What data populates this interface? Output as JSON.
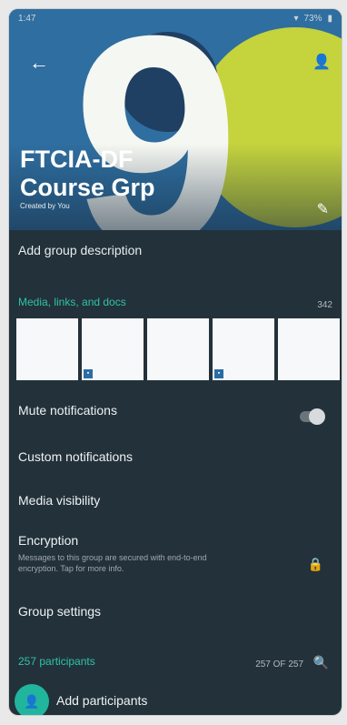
{
  "status_bar": {
    "time": "1:47",
    "battery": "73%"
  },
  "header": {
    "title_line1": "FTCIA-DF",
    "title_line2": "Course",
    "title_suffix": "Grp",
    "created_by": "Created by You",
    "big_number": "9"
  },
  "description": "Add group description",
  "media": {
    "label": "Media, links, and docs",
    "count": "342"
  },
  "options": {
    "mute": "Mute notifications",
    "custom": "Custom notifications",
    "media_visibility": "Media visibility",
    "encryption_title": "Encryption",
    "encryption_sub": "Messages to this group are secured with end-to-end encryption. Tap for more info.",
    "group_settings": "Group settings"
  },
  "participants": {
    "label": "257 participants",
    "count": "257 OF 257",
    "add_label": "Add participants"
  },
  "colors": {
    "accent": "#2ec4a6",
    "background": "#23313a"
  },
  "icons": [
    "back-arrow-icon",
    "add-person-icon",
    "edit-icon",
    "lock-icon",
    "search-icon",
    "add-participant-icon",
    "wifi-icon",
    "battery-icon"
  ]
}
